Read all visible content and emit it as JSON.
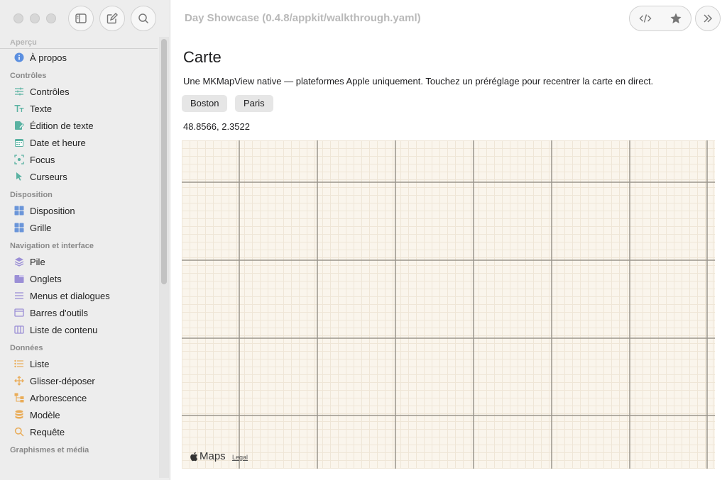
{
  "window": {
    "title": "Day Showcase (0.4.8/appkit/walkthrough.yaml)"
  },
  "sidebar": {
    "partial_top_header": "Aperçu",
    "about": "À propos",
    "sections": [
      {
        "header": "Contrôles",
        "items": [
          {
            "label": "Contrôles",
            "icon": "sliders-icon",
            "color": "#5ab2a2"
          },
          {
            "label": "Texte",
            "icon": "text-icon",
            "color": "#5ab2a2"
          },
          {
            "label": "Édition de texte",
            "icon": "edit-doc-icon",
            "color": "#5ab2a2"
          },
          {
            "label": "Date et heure",
            "icon": "calendar-icon",
            "color": "#5ab2a2"
          },
          {
            "label": "Focus",
            "icon": "focus-icon",
            "color": "#5ab2a2"
          },
          {
            "label": "Curseurs",
            "icon": "cursor-icon",
            "color": "#5ab2a2"
          }
        ]
      },
      {
        "header": "Disposition",
        "items": [
          {
            "label": "Disposition",
            "icon": "layout-icon",
            "color": "#6a95d9"
          },
          {
            "label": "Grille",
            "icon": "grid-icon",
            "color": "#6a95d9"
          }
        ]
      },
      {
        "header": "Navigation et interface",
        "items": [
          {
            "label": "Pile",
            "icon": "stack-icon",
            "color": "#9b8fd6"
          },
          {
            "label": "Onglets",
            "icon": "tabs-icon",
            "color": "#9b8fd6"
          },
          {
            "label": "Menus et dialogues",
            "icon": "menu-icon",
            "color": "#9b8fd6"
          },
          {
            "label": "Barres d'outils",
            "icon": "toolbar-icon",
            "color": "#9b8fd6"
          },
          {
            "label": "Liste de contenu",
            "icon": "columns-icon",
            "color": "#9b8fd6"
          }
        ]
      },
      {
        "header": "Données",
        "items": [
          {
            "label": "Liste",
            "icon": "list-icon",
            "color": "#e9ac58"
          },
          {
            "label": "Glisser-déposer",
            "icon": "move-icon",
            "color": "#e9ac58"
          },
          {
            "label": "Arborescence",
            "icon": "tree-icon",
            "color": "#e9ac58"
          },
          {
            "label": "Modèle",
            "icon": "database-icon",
            "color": "#e9ac58"
          },
          {
            "label": "Requête",
            "icon": "search-icon",
            "color": "#e9ac58"
          }
        ]
      }
    ],
    "partial_bottom_header": "Graphismes et média"
  },
  "content": {
    "title": "Carte",
    "description": "Une MKMapView native — plateformes Apple uniquement. Touchez un préréglage pour recentrer la carte en direct.",
    "presets": [
      "Boston",
      "Paris"
    ],
    "coordinates": "48.8566, 2.3522"
  },
  "map": {
    "logo_text": "Maps",
    "legal_text": "Legal"
  },
  "colors": {
    "about_icon": "#5b8fe0"
  }
}
